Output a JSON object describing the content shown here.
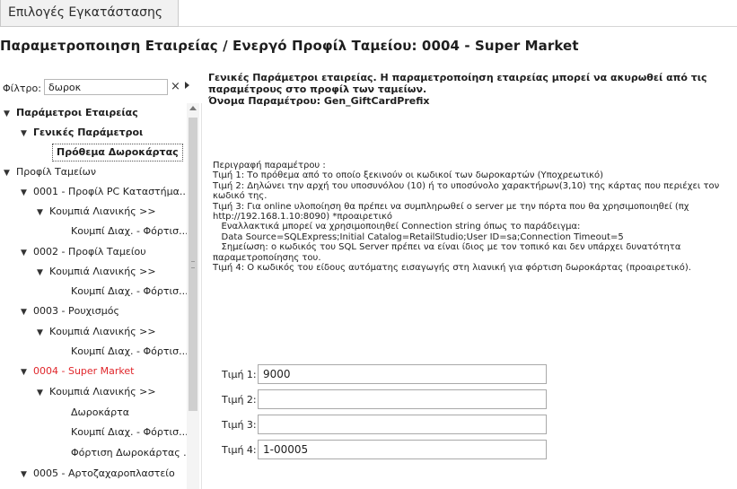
{
  "tab": {
    "label": "Επιλογές Εγκατάστασης"
  },
  "page_title": "Παραμετροποιηση Εταιρείας / Ενεργό Προφίλ Ταμείου: 0004 - Super Market",
  "filter": {
    "label": "Φίλτρο:",
    "value": "δωροκ",
    "clear_icon": "×"
  },
  "tree": [
    {
      "label": "Παράμετροι Εταιρείας",
      "bold": true
    },
    {
      "label": "Γενικές Παράμετροι",
      "bold": true
    },
    {
      "label": "Πρόθεμα Δωροκάρτας",
      "selected": true
    },
    {
      "label": "Προφίλ Ταμείων"
    },
    {
      "label": "0001 - Προφίλ PC Καταστήμα..."
    },
    {
      "label": "Κουμπιά Λιανικής >>"
    },
    {
      "label": "Κουμπί Διαχ. - Φόρτισ..."
    },
    {
      "label": "0002 - Προφίλ Ταμείου"
    },
    {
      "label": "Κουμπιά Λιανικής >>"
    },
    {
      "label": "Κουμπί Διαχ. - Φόρτισ..."
    },
    {
      "label": "0003 - Ρουχισμός"
    },
    {
      "label": "Κουμπιά Λιανικής >>"
    },
    {
      "label": "Κουμπί Διαχ. - Φόρτισ..."
    },
    {
      "label": "0004 - Super Market",
      "red": true
    },
    {
      "label": "Κουμπιά Λιανικής >>"
    },
    {
      "label": "Δωροκάρτα"
    },
    {
      "label": "Κουμπί Διαχ. - Φόρτισ..."
    },
    {
      "label": "Φόρτιση Δωροκάρτας ..."
    },
    {
      "label": "0005 - Αρτοζαχαροπλαστείο"
    }
  ],
  "header": {
    "line1": "Γενικές Παράμετροι εταιρείας. Η παραμετροποίηση εταιρείας μπορεί να ακυρωθεί από τις",
    "line2": "παραμέτρους στο προφίλ των ταμείων.",
    "line3": "Όνομα Παραμέτρου: Gen_GiftCardPrefix"
  },
  "description": [
    "Περιγραφή παραμέτρου :",
    "Τιμή 1: Το πρόθεμα από το οποίο ξεκινούν οι κωδικοί των δωροκαρτών (Υποχρεωτικό)",
    "Τιμή 2: Δηλώνει την αρχή του υποσυνόλου (10) ή το υποσύνολο χαρακτήρων(3,10) της κάρτας που περιέχει τον",
    "κωδικό της.",
    "Τιμή 3: Για online υλοποίηση θα πρέπει να συμπληρωθεί ο server με την πόρτα που θα χρησιμοποιηθεί (πχ",
    "http://192.168.1.10:8090) *προαιρετικό",
    "   Εναλλακτικά μπορεί να χρησιμοποιηθεί Connection string όπως το παράδειγμα:",
    "   Data Source=SQLExpress;Initial Catalog=RetailStudio;User ID=sa;Connection Timeout=5",
    "   Σημείωση: ο κωδικός του SQL Server πρέπει να είναι ίδιος με τον τοπικό και δεν υπάρχει δυνατότητα",
    "παραμετροποίησης του.",
    "Τιμή 4: Ο κωδικός του είδους αυτόματης εισαγωγής στη λιανική για φόρτιση δωροκάρτας (προαιρετικό)."
  ],
  "params": [
    {
      "label": "Τιμή 1:",
      "value": "9000"
    },
    {
      "label": "Τιμή 2:",
      "value": ""
    },
    {
      "label": "Τιμή 3:",
      "value": ""
    },
    {
      "label": "Τιμή 4:",
      "value": "1-00005"
    }
  ]
}
